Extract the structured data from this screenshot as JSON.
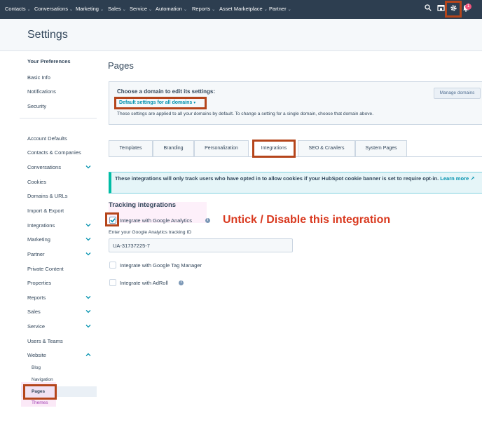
{
  "topnav": {
    "items": [
      {
        "label": "Contacts"
      },
      {
        "label": "Conversations"
      },
      {
        "label": "Marketing"
      },
      {
        "label": "Sales"
      },
      {
        "label": "Service"
      },
      {
        "label": "Automation"
      },
      {
        "label": "Reports"
      },
      {
        "label": "Asset Marketplace"
      },
      {
        "label": "Partner"
      }
    ],
    "icons": [
      "search-icon",
      "marketplace-icon",
      "gear-icon",
      "notifications-icon"
    ],
    "badge_count": "1"
  },
  "header": {
    "title": "Settings"
  },
  "sidebar": {
    "preferences": {
      "heading": "Your Preferences",
      "items": [
        "Basic Info",
        "Notifications",
        "Security"
      ]
    },
    "account": {
      "items": [
        {
          "label": "Account Defaults",
          "expandable": false
        },
        {
          "label": "Contacts & Companies",
          "expandable": false
        },
        {
          "label": "Conversations",
          "expandable": true
        },
        {
          "label": "Cookies",
          "expandable": false
        },
        {
          "label": "Domains & URLs",
          "expandable": false
        },
        {
          "label": "Import & Export",
          "expandable": false
        },
        {
          "label": "Integrations",
          "expandable": true
        },
        {
          "label": "Marketing",
          "expandable": true
        },
        {
          "label": "Partner",
          "expandable": true
        },
        {
          "label": "Private Content",
          "expandable": false
        },
        {
          "label": "Properties",
          "expandable": false
        },
        {
          "label": "Reports",
          "expandable": true
        },
        {
          "label": "Sales",
          "expandable": true
        },
        {
          "label": "Service",
          "expandable": true
        },
        {
          "label": "Users & Teams",
          "expandable": false
        },
        {
          "label": "Website",
          "expandable": true
        }
      ]
    },
    "website_sub": [
      "Blog",
      "Navigation",
      "Pages",
      "Themes"
    ],
    "active": "Pages"
  },
  "main": {
    "title": "Pages",
    "domain": {
      "heading": "Choose a domain to edit its settings:",
      "selected": "Default settings for all domains",
      "note": "These settings are applied to all your domains by default. To change a setting for a single domain, choose that domain above.",
      "manage_button": "Manage domains"
    },
    "tabs": [
      "Templates",
      "Branding",
      "Personalization",
      "Integrations",
      "SEO & Crawlers",
      "System Pages"
    ],
    "active_tab": "Integrations",
    "banner": {
      "text": "These integrations will only track users who have opted in to allow cookies if your HubSpot cookie banner is set to require opt-in.",
      "link": "Learn more"
    },
    "tracking": {
      "title": "Tracking integrations",
      "google_analytics": {
        "label": "Integrate with Google Analytics",
        "checked": true
      },
      "tracking_id_label": "Enter your Google Analytics tracking ID",
      "tracking_id_value": "UA-31737225-7",
      "tag_manager": {
        "label": "Integrate with Google Tag Manager",
        "checked": false
      },
      "adroll": {
        "label": "Integrate with AdRoll",
        "checked": false
      }
    }
  },
  "annotation": {
    "text": "Untick  / Disable this integration",
    "color": "#d9391f"
  },
  "colors": {
    "nav_bg": "#2d3e50",
    "accent": "#0091ae",
    "highlight_border": "#b5451b"
  }
}
